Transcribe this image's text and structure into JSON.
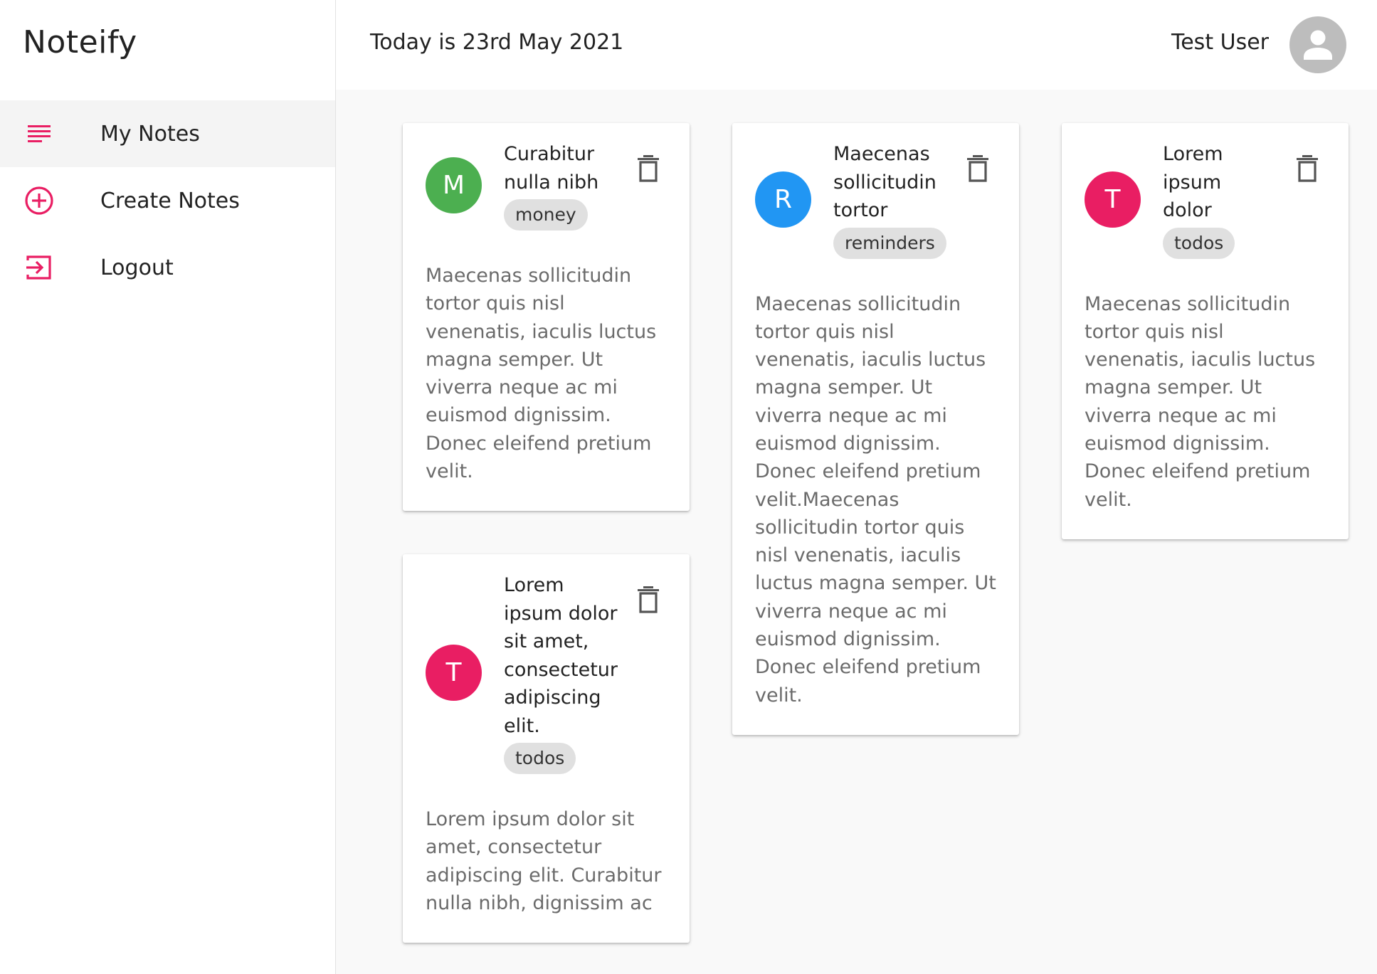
{
  "app": {
    "brand": "Noteify"
  },
  "sidebar": {
    "items": [
      {
        "label": "My Notes",
        "icon": "list-icon",
        "active": true
      },
      {
        "label": "Create Notes",
        "icon": "add-circle-icon",
        "active": false
      },
      {
        "label": "Logout",
        "icon": "logout-icon",
        "active": false
      }
    ]
  },
  "header": {
    "date_text": "Today is 23rd May 2021",
    "user_name": "Test User",
    "avatar_icon": "person-icon"
  },
  "notes": [
    {
      "initial": "M",
      "avatar_color": "#4caf50",
      "title": "Curabitur nulla nibh",
      "category": "money",
      "body": "Maecenas sollicitudin tortor quis nisl venenatis, iaculis luctus magna semper. Ut viverra neque ac mi euismod dignissim. Donec eleifend pretium velit."
    },
    {
      "initial": "R",
      "avatar_color": "#2196f3",
      "title": "Maecenas sollicitudin tortor",
      "category": "reminders",
      "body": "Maecenas sollicitudin tortor quis nisl venenatis, iaculis luctus magna semper. Ut viverra neque ac mi euismod dignissim. Donec eleifend pretium velit.Maecenas sollicitudin tortor quis nisl venenatis, iaculis luctus magna semper. Ut viverra neque ac mi euismod dignissim. Donec eleifend pretium velit."
    },
    {
      "initial": "T",
      "avatar_color": "#e91e63",
      "title": "Lorem ipsum dolor",
      "category": "todos",
      "body": "Maecenas sollicitudin tortor quis nisl venenatis, iaculis luctus magna semper. Ut viverra neque ac mi euismod dignissim. Donec eleifend pretium velit."
    },
    {
      "initial": "T",
      "avatar_color": "#e91e63",
      "title": "Lorem ipsum dolor sit amet, consectetur adipiscing elit.",
      "category": "todos",
      "body": "Lorem ipsum dolor sit amet, consectetur adipiscing elit. Curabitur nulla nibh, dignissim ac"
    }
  ],
  "colors": {
    "accent": "#e91e63",
    "delete_icon": "#555555"
  }
}
